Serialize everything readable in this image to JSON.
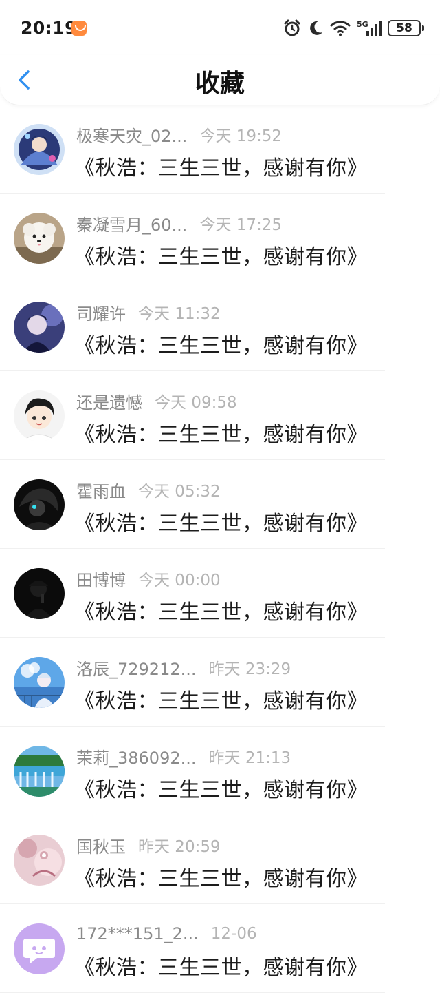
{
  "status_bar": {
    "time": "20:19",
    "battery": "58",
    "icons": [
      "alarm-icon",
      "moon-icon",
      "wifi-icon",
      "5g-signal-icon"
    ]
  },
  "header": {
    "title": "收藏",
    "back_icon": "chevron-left-icon",
    "accent": "#2f8ff0"
  },
  "items": [
    {
      "user": "极寒天灾_02...",
      "time": "今天 19:52",
      "title": "《秋浩：三生三世，感谢有你》"
    },
    {
      "user": "秦凝雪月_60...",
      "time": "今天 17:25",
      "title": "《秋浩：三生三世，感谢有你》"
    },
    {
      "user": "司耀许",
      "time": "今天 11:32",
      "title": "《秋浩：三生三世，感谢有你》"
    },
    {
      "user": "还是遗憾",
      "time": "今天 09:58",
      "title": "《秋浩：三生三世，感谢有你》"
    },
    {
      "user": "霍雨血",
      "time": "今天 05:32",
      "title": "《秋浩：三生三世，感谢有你》"
    },
    {
      "user": "田博博",
      "time": "今天 00:00",
      "title": "《秋浩：三生三世，感谢有你》"
    },
    {
      "user": "洛辰_729212...",
      "time": "昨天 23:29",
      "title": "《秋浩：三生三世，感谢有你》"
    },
    {
      "user": "茉莉_386092...",
      "time": "昨天 21:13",
      "title": "《秋浩：三生三世，感谢有你》"
    },
    {
      "user": "国秋玉",
      "time": "昨天 20:59",
      "title": "《秋浩：三生三世，感谢有你》"
    },
    {
      "user": "172***151_2...",
      "time": "12-06",
      "title": "《秋浩：三生三世，感谢有你》"
    }
  ]
}
